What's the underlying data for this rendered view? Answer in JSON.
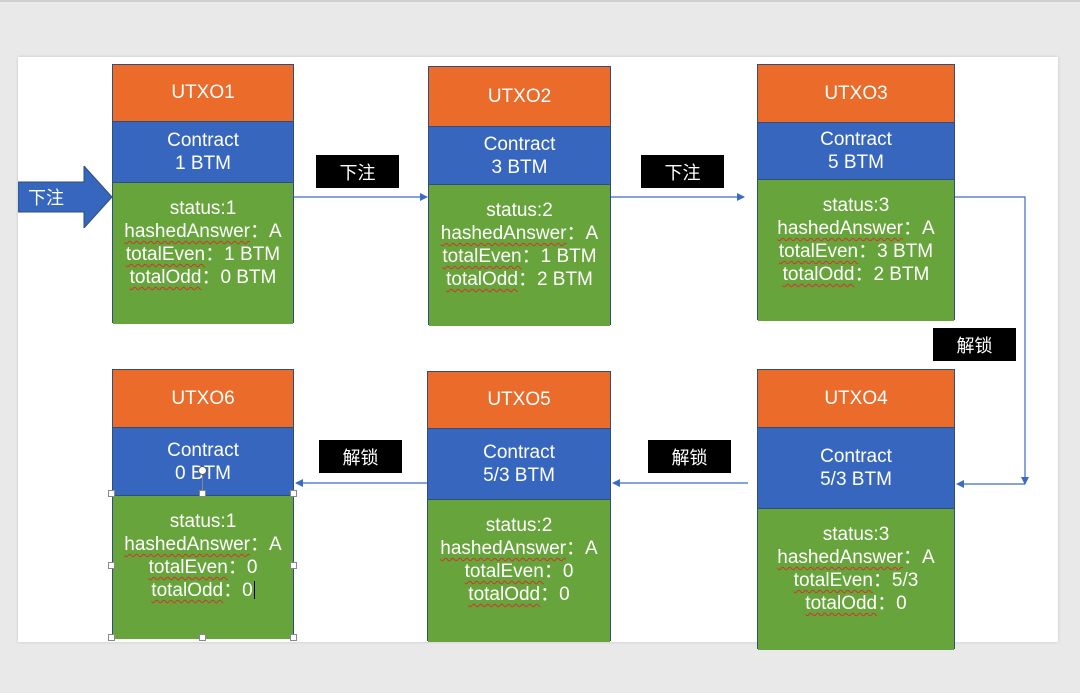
{
  "labels": {
    "bet": "下注",
    "unlock": "解锁"
  },
  "blocks": [
    {
      "title": "UTXO1",
      "contract": "Contract",
      "amount": "1 BTM",
      "status": "status:1",
      "hashed_key": "hashedAnswer",
      "hashed_val": "：A",
      "even_key": "totalEven",
      "even_val": "：1 BTM",
      "odd_key": "totalOdd",
      "odd_val": "：0 BTM"
    },
    {
      "title": "UTXO2",
      "contract": "Contract",
      "amount": "3 BTM",
      "status": "status:2",
      "hashed_key": "hashedAnswer",
      "hashed_val": "：A",
      "even_key": "totalEven",
      "even_val": "：1 BTM",
      "odd_key": "totalOdd",
      "odd_val": "：2 BTM"
    },
    {
      "title": "UTXO3",
      "contract": "Contract",
      "amount": "5 BTM",
      "status": "status:3",
      "hashed_key": "hashedAnswer",
      "hashed_val": "：A",
      "even_key": "totalEven",
      "even_val": "：3 BTM",
      "odd_key": "totalOdd",
      "odd_val": "：2 BTM"
    },
    {
      "title": "UTXO4",
      "contract": "Contract",
      "amount": "5/3 BTM",
      "status": "status:3",
      "hashed_key": "hashedAnswer",
      "hashed_val": "：A",
      "even_key": "totalEven",
      "even_val": "：5/3",
      "odd_key": "totalOdd",
      "odd_val": "：0"
    },
    {
      "title": "UTXO5",
      "contract": "Contract",
      "amount": "5/3 BTM",
      "status": "status:2",
      "hashed_key": "hashedAnswer",
      "hashed_val": "：A",
      "even_key": "totalEven",
      "even_val": "：0",
      "odd_key": "totalOdd",
      "odd_val": "：0"
    },
    {
      "title": "UTXO6",
      "contract": "Contract",
      "amount": "0 BTM",
      "status": "status:1",
      "hashed_key": "hashedAnswer",
      "hashed_val": "：A",
      "even_key": "totalEven",
      "even_val": "：0",
      "odd_key": "totalOdd",
      "odd_val": "：0"
    }
  ],
  "colors": {
    "header": "#ea6b2a",
    "contract": "#3766bf",
    "body": "#67a43b",
    "connector": "#3a6cc4"
  }
}
